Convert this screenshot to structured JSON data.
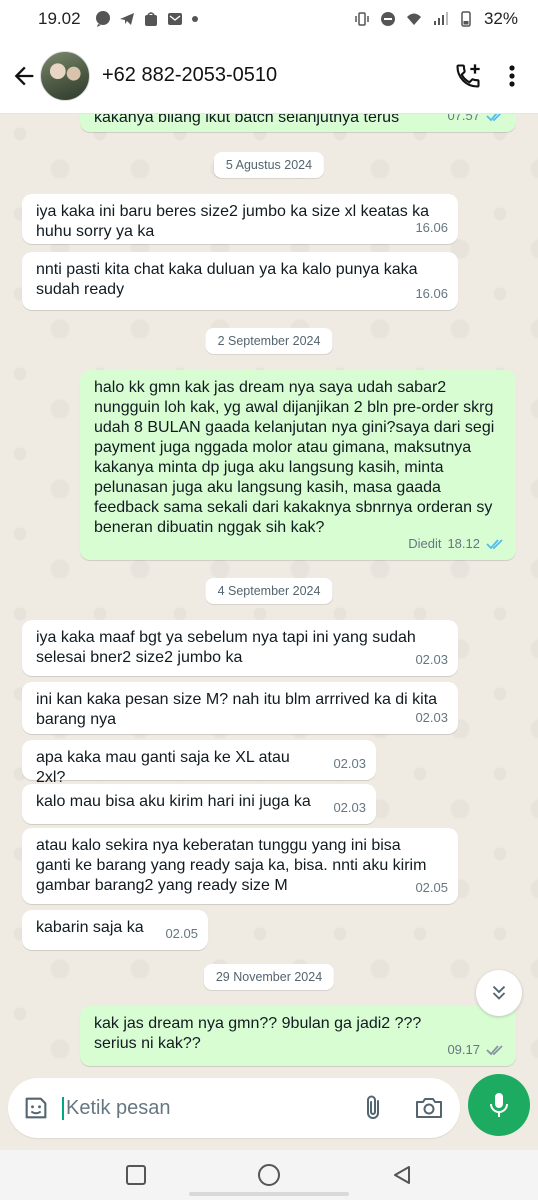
{
  "status_bar": {
    "time": "19.02",
    "battery": "32%"
  },
  "header": {
    "contact_name": "+62 882-2053-0510",
    "icons": [
      "back-arrow-icon",
      "add-call-icon",
      "more-vertical-icon"
    ]
  },
  "messages": [
    {
      "type": "out",
      "text": "kakanya bilang ikut batch selanjutnya terus",
      "time": "07.57",
      "ticks": "read"
    },
    {
      "type": "date",
      "text": "5 Agustus 2024"
    },
    {
      "type": "in",
      "text": "iya kaka ini baru beres size2 jumbo ka size xl keatas ka huhu sorry ya ka",
      "time": "16.06"
    },
    {
      "type": "in",
      "text": "nnti pasti kita chat kaka duluan ya ka kalo punya kaka sudah ready",
      "time": "16.06"
    },
    {
      "type": "date",
      "text": "2 September 2024"
    },
    {
      "type": "out",
      "text": "halo kk gmn kak jas dream nya saya udah sabar2 nungguin loh kak, yg awal dijanjikan 2 bln pre-order skrg udah 8 BULAN gaada kelanjutan nya gini?saya dari segi payment juga nggada molor atau gimana, maksutnya kakanya minta dp juga aku langsung kasih, minta pelunasan juga aku langsung kasih, masa gaada feedback sama sekali dari kakaknya sbnrnya orderan sy beneran dibuatin nggak sih kak?",
      "edited": "Diedit",
      "time": "18.12",
      "ticks": "read"
    },
    {
      "type": "date",
      "text": "4 September 2024"
    },
    {
      "type": "in",
      "text": "iya kaka maaf bgt ya sebelum nya tapi ini yang sudah selesai bner2 size2 jumbo ka",
      "time": "02.03"
    },
    {
      "type": "in",
      "text": "ini kan kaka pesan size M? nah itu blm arrrived ka di kita barang nya",
      "time": "02.03"
    },
    {
      "type": "in",
      "text": "apa kaka mau ganti saja ke XL atau 2xl?",
      "time": "02.03"
    },
    {
      "type": "in",
      "text": "kalo mau bisa aku kirim hari ini juga ka",
      "time": "02.03"
    },
    {
      "type": "in",
      "text": "atau kalo sekira nya keberatan tunggu yang ini bisa ganti ke barang yang ready saja ka, bisa. nnti aku kirim gambar barang2 yang ready size M",
      "time": "02.05"
    },
    {
      "type": "in",
      "text": "kabarin saja ka",
      "time": "02.05"
    },
    {
      "type": "date",
      "text": "29 November 2024"
    },
    {
      "type": "out",
      "text": "kak jas dream nya gmn?? 9bulan ga jadi2 ??? serius ni kak??",
      "time": "09.17",
      "ticks": "delivered"
    }
  ],
  "composer": {
    "placeholder": "Ketik pesan"
  },
  "colors": {
    "accent": "#1daa61",
    "outgoing_bubble": "#d9fdd3",
    "incoming_bubble": "#ffffff",
    "chat_background": "#efeae2",
    "read_ticks": "#53bdeb"
  }
}
